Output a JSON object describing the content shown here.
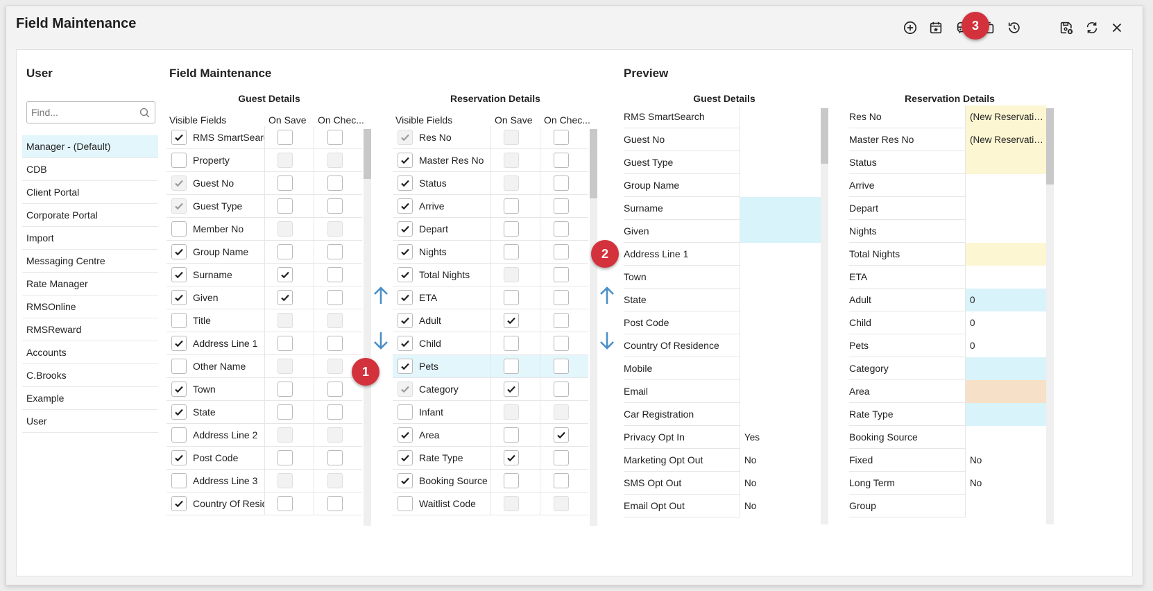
{
  "window": {
    "title": "Field Maintenance"
  },
  "toolbar": [
    "add-icon",
    "calendar-icon",
    "vehicle-icon",
    "copy-icon",
    "history-icon",
    "save-icon",
    "refresh-icon",
    "close-icon"
  ],
  "user_panel": {
    "heading": "User",
    "search_placeholder": "Find...",
    "items": [
      "Manager - (Default)",
      "CDB",
      "Client Portal",
      "Corporate Portal",
      "Import",
      "Messaging Centre",
      "Rate Manager",
      "RMSOnline",
      "RMSReward",
      "Accounts",
      "C.Brooks",
      "Example",
      "User"
    ],
    "selected": "Manager - (Default)"
  },
  "field_maintenance": {
    "heading": "Field Maintenance",
    "guest": {
      "title": "Guest Details",
      "headers": {
        "visible": "Visible Fields",
        "on_save": "On Save",
        "on_check": "On Chec..."
      },
      "rows": [
        {
          "name": "RMS SmartSearch",
          "visible": "checked",
          "save": "unchecked",
          "check": "unchecked"
        },
        {
          "name": "Property",
          "visible": "unchecked",
          "save": "disabled",
          "check": "disabled"
        },
        {
          "name": "Guest No",
          "visible": "disabled-checked",
          "save": "unchecked",
          "check": "unchecked"
        },
        {
          "name": "Guest Type",
          "visible": "disabled-checked",
          "save": "unchecked",
          "check": "unchecked"
        },
        {
          "name": "Member No",
          "visible": "unchecked",
          "save": "disabled",
          "check": "disabled"
        },
        {
          "name": "Group Name",
          "visible": "checked",
          "save": "unchecked",
          "check": "unchecked"
        },
        {
          "name": "Surname",
          "visible": "checked",
          "save": "checked",
          "check": "unchecked"
        },
        {
          "name": "Given",
          "visible": "checked",
          "save": "checked",
          "check": "unchecked"
        },
        {
          "name": "Title",
          "visible": "unchecked",
          "save": "disabled",
          "check": "disabled"
        },
        {
          "name": "Address Line 1",
          "visible": "checked",
          "save": "unchecked",
          "check": "unchecked"
        },
        {
          "name": "Other Name",
          "visible": "unchecked",
          "save": "disabled",
          "check": "disabled"
        },
        {
          "name": "Town",
          "visible": "checked",
          "save": "unchecked",
          "check": "unchecked"
        },
        {
          "name": "State",
          "visible": "checked",
          "save": "unchecked",
          "check": "unchecked"
        },
        {
          "name": "Address Line 2",
          "visible": "unchecked",
          "save": "disabled",
          "check": "disabled"
        },
        {
          "name": "Post Code",
          "visible": "checked",
          "save": "unchecked",
          "check": "unchecked"
        },
        {
          "name": "Address Line 3",
          "visible": "unchecked",
          "save": "disabled",
          "check": "disabled"
        },
        {
          "name": "Country Of Residence",
          "visible": "checked",
          "save": "unchecked",
          "check": "unchecked"
        }
      ]
    },
    "reservation": {
      "title": "Reservation Details",
      "headers": {
        "visible": "Visible Fields",
        "on_save": "On Save",
        "on_check": "On Chec..."
      },
      "highlighted": "Pets",
      "rows": [
        {
          "name": "Res No",
          "visible": "disabled-checked",
          "save": "disabled",
          "check": "unchecked"
        },
        {
          "name": "Master Res No",
          "visible": "checked",
          "save": "disabled",
          "check": "unchecked"
        },
        {
          "name": "Status",
          "visible": "checked",
          "save": "disabled",
          "check": "unchecked"
        },
        {
          "name": "Arrive",
          "visible": "checked",
          "save": "unchecked",
          "check": "unchecked"
        },
        {
          "name": "Depart",
          "visible": "checked",
          "save": "unchecked",
          "check": "unchecked"
        },
        {
          "name": "Nights",
          "visible": "checked",
          "save": "unchecked",
          "check": "unchecked"
        },
        {
          "name": "Total Nights",
          "visible": "checked",
          "save": "disabled",
          "check": "unchecked"
        },
        {
          "name": "ETA",
          "visible": "checked",
          "save": "unchecked",
          "check": "unchecked"
        },
        {
          "name": "Adult",
          "visible": "checked",
          "save": "checked",
          "check": "unchecked"
        },
        {
          "name": "Child",
          "visible": "checked",
          "save": "unchecked",
          "check": "unchecked"
        },
        {
          "name": "Pets",
          "visible": "checked",
          "save": "unchecked",
          "check": "unchecked"
        },
        {
          "name": "Category",
          "visible": "disabled-checked",
          "save": "checked",
          "check": "unchecked"
        },
        {
          "name": "Infant",
          "visible": "unchecked",
          "save": "disabled",
          "check": "disabled"
        },
        {
          "name": "Area",
          "visible": "checked",
          "save": "unchecked",
          "check": "checked"
        },
        {
          "name": "Rate Type",
          "visible": "checked",
          "save": "checked",
          "check": "unchecked"
        },
        {
          "name": "Booking Source",
          "visible": "checked",
          "save": "unchecked",
          "check": "unchecked"
        },
        {
          "name": "Waitlist Code",
          "visible": "unchecked",
          "save": "disabled",
          "check": "disabled"
        }
      ]
    }
  },
  "preview": {
    "heading": "Preview",
    "guest": {
      "title": "Guest Details",
      "rows": [
        {
          "label": "RMS SmartSearch",
          "value": "",
          "color": "#ffffff"
        },
        {
          "label": "Guest No",
          "value": "",
          "color": "#ffffff"
        },
        {
          "label": "Guest Type",
          "value": "",
          "color": "#ffffff"
        },
        {
          "label": "Group Name",
          "value": "",
          "color": "#ffffff"
        },
        {
          "label": "Surname",
          "value": "",
          "color": "#d9f3fa"
        },
        {
          "label": "Given",
          "value": "",
          "color": "#d9f3fa"
        },
        {
          "label": "Address Line 1",
          "value": "",
          "color": "#ffffff"
        },
        {
          "label": "Town",
          "value": "",
          "color": "#ffffff"
        },
        {
          "label": "State",
          "value": "",
          "color": "#ffffff"
        },
        {
          "label": "Post Code",
          "value": "",
          "color": "#ffffff"
        },
        {
          "label": "Country Of Residence",
          "value": "",
          "color": "#ffffff"
        },
        {
          "label": "Mobile",
          "value": "",
          "color": "#ffffff"
        },
        {
          "label": "Email",
          "value": "",
          "color": "#ffffff"
        },
        {
          "label": "Car Registration",
          "value": "",
          "color": "#ffffff"
        },
        {
          "label": "Privacy Opt In",
          "value": "Yes",
          "color": "#ffffff"
        },
        {
          "label": "Marketing Opt Out",
          "value": "No",
          "color": "#ffffff"
        },
        {
          "label": "SMS Opt Out",
          "value": "No",
          "color": "#ffffff"
        },
        {
          "label": "Email Opt Out",
          "value": "No",
          "color": "#ffffff"
        }
      ]
    },
    "reservation": {
      "title": "Reservation Details",
      "rows": [
        {
          "label": "Res No",
          "value": "(New Reservation)",
          "color": "#fdf6d2"
        },
        {
          "label": "Master Res No",
          "value": "(New Reservation)",
          "color": "#fdf6d2"
        },
        {
          "label": "Status",
          "value": "",
          "color": "#fdf6d2"
        },
        {
          "label": "Arrive",
          "value": "",
          "color": "#ffffff"
        },
        {
          "label": "Depart",
          "value": "",
          "color": "#ffffff"
        },
        {
          "label": "Nights",
          "value": "",
          "color": "#ffffff"
        },
        {
          "label": "Total Nights",
          "value": "",
          "color": "#fdf6d2"
        },
        {
          "label": "ETA",
          "value": "",
          "color": "#ffffff"
        },
        {
          "label": "Adult",
          "value": "0",
          "color": "#d9f3fa"
        },
        {
          "label": "Child",
          "value": "0",
          "color": "#ffffff"
        },
        {
          "label": "Pets",
          "value": "0",
          "color": "#ffffff"
        },
        {
          "label": "Category",
          "value": "",
          "color": "#d9f3fa"
        },
        {
          "label": "Area",
          "value": "",
          "color": "#f6e0c7"
        },
        {
          "label": "Rate Type",
          "value": "",
          "color": "#d9f3fa"
        },
        {
          "label": "Booking Source",
          "value": "",
          "color": "#ffffff"
        },
        {
          "label": "Fixed",
          "value": "No",
          "color": "#ffffff"
        },
        {
          "label": "Long Term",
          "value": "No",
          "color": "#ffffff"
        },
        {
          "label": "Group",
          "value": "",
          "color": "#ffffff"
        }
      ]
    }
  },
  "callouts": [
    "1",
    "2",
    "3"
  ],
  "colors": {
    "accent_arrow": "#4a8fc9",
    "callout": "#d3323d",
    "selected_row": "#e3f6fc"
  }
}
